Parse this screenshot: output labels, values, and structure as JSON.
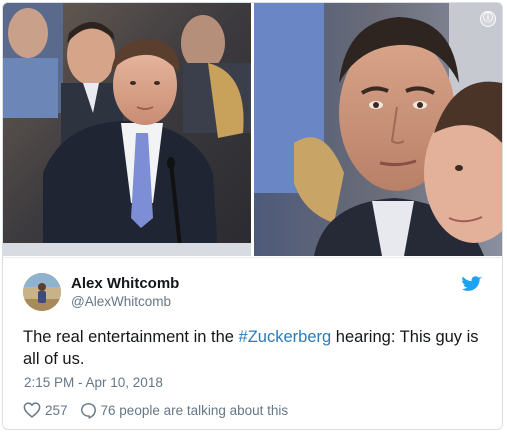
{
  "tweet": {
    "author": {
      "name": "Alex Whitcomb",
      "handle": "@AlexWhitcomb"
    },
    "text_before": "The real entertainment in the ",
    "hashtag": "#Zuckerberg",
    "text_after": " hearing: This guy is all of us.",
    "timestamp": "2:15 PM - Apr 10, 2018",
    "likes": "257",
    "conversation": "76 people are talking about this"
  },
  "media": {
    "info_icon": "ⓘ"
  },
  "icons": {
    "bird": "twitter-bird-icon",
    "heart": "heart-icon",
    "reply": "reply-bubble-icon",
    "info": "info-icon"
  },
  "colors": {
    "link": "#2b7bb9",
    "bird": "#1da1f2",
    "secondary_text": "#657786",
    "primary_text": "#14171a"
  }
}
